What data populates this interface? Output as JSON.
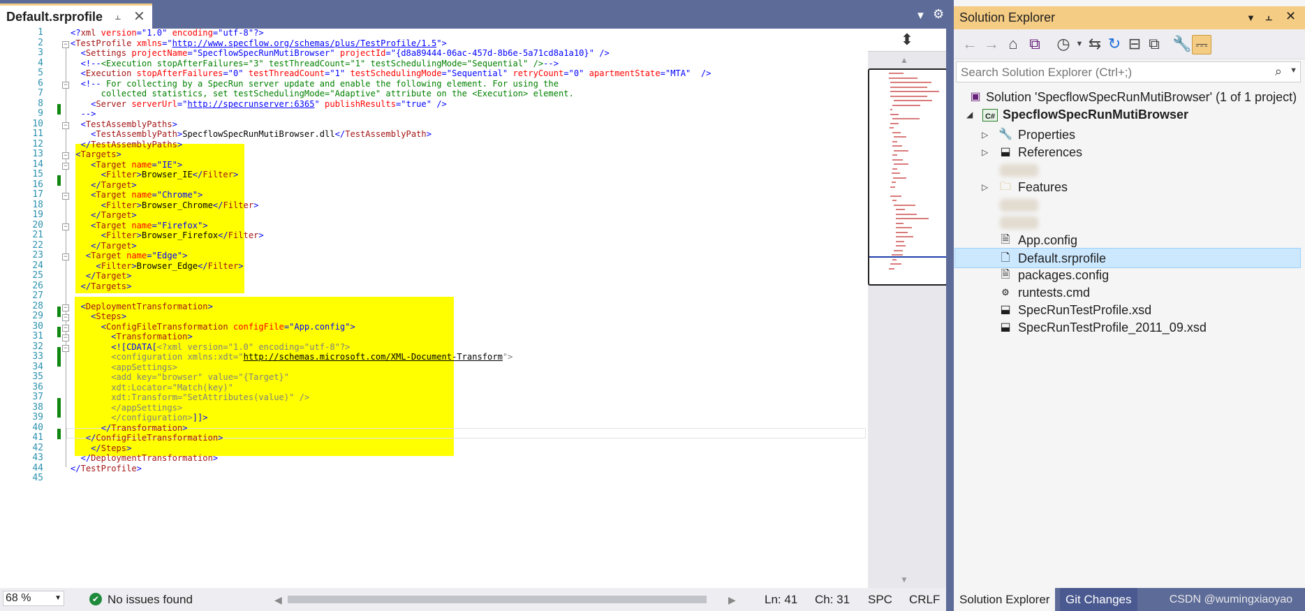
{
  "editor": {
    "tab_title": "Default.srprofile",
    "pin_icon": "pin-icon",
    "close_icon": "close-icon",
    "code_lines": [
      [
        [
          "b",
          "<?"
        ],
        [
          "e",
          "xml"
        ],
        [
          "a",
          " version"
        ],
        [
          "b",
          "=\""
        ],
        [
          "v",
          "1.0"
        ],
        [
          "b",
          "\""
        ],
        [
          "a",
          " encoding"
        ],
        [
          "b",
          "=\""
        ],
        [
          "v",
          "utf-8"
        ],
        [
          "b",
          "\"?>"
        ]
      ],
      [
        [
          "b",
          "<"
        ],
        [
          "e",
          "TestProfile"
        ],
        [
          "a",
          " xmlns"
        ],
        [
          "b",
          "=\""
        ],
        [
          "u",
          "http://www.specflow.org/schemas/plus/TestProfile/1.5"
        ],
        [
          "b",
          "\">"
        ]
      ],
      [
        [
          "k",
          "  "
        ],
        [
          "b",
          "<"
        ],
        [
          "e",
          "Settings"
        ],
        [
          "a",
          " projectName"
        ],
        [
          "b",
          "=\""
        ],
        [
          "v",
          "SpecflowSpecRunMutiBrowser"
        ],
        [
          "b",
          "\""
        ],
        [
          "a",
          " projectId"
        ],
        [
          "b",
          "=\""
        ],
        [
          "v",
          "{d8a89444-06ac-457d-8b6e-5a71cd8a1a10}"
        ],
        [
          "b",
          "\""
        ],
        [
          "b",
          " />"
        ]
      ],
      [
        [
          "k",
          "  "
        ],
        [
          "b",
          "<!--"
        ],
        [
          "c",
          "<Execution stopAfterFailures=\"3\" testThreadCount=\"1\" testSchedulingMode=\"Sequential\" />"
        ],
        [
          "b",
          "-->"
        ]
      ],
      [
        [
          "k",
          "  "
        ],
        [
          "b",
          "<"
        ],
        [
          "e",
          "Execution"
        ],
        [
          "a",
          " stopAfterFailures"
        ],
        [
          "b",
          "=\""
        ],
        [
          "v",
          "0"
        ],
        [
          "b",
          "\""
        ],
        [
          "a",
          " testThreadCount"
        ],
        [
          "b",
          "=\""
        ],
        [
          "v",
          "1"
        ],
        [
          "b",
          "\""
        ],
        [
          "a",
          " testSchedulingMode"
        ],
        [
          "b",
          "=\""
        ],
        [
          "v",
          "Sequential"
        ],
        [
          "b",
          "\""
        ],
        [
          "a",
          " retryCount"
        ],
        [
          "b",
          "=\""
        ],
        [
          "v",
          "0"
        ],
        [
          "b",
          "\""
        ],
        [
          "a",
          " apartmentState"
        ],
        [
          "b",
          "=\""
        ],
        [
          "v",
          "MTA"
        ],
        [
          "b",
          "\""
        ],
        [
          "b",
          "  />"
        ]
      ],
      [
        [
          "k",
          "  "
        ],
        [
          "b",
          "<!--"
        ],
        [
          "c",
          " For collecting by a SpecRun server update and enable the following element. For using the"
        ]
      ],
      [
        [
          "c",
          "      collected statistics, set testSchedulingMode=\"Adaptive\" attribute on the <Execution> element."
        ]
      ],
      [
        [
          "k",
          "    "
        ],
        [
          "b",
          "<"
        ],
        [
          "e",
          "Server"
        ],
        [
          "a",
          " serverUrl"
        ],
        [
          "b",
          "=\""
        ],
        [
          "u",
          "http://specrunserver:6365"
        ],
        [
          "b",
          "\""
        ],
        [
          "a",
          " publishResults"
        ],
        [
          "b",
          "=\""
        ],
        [
          "v",
          "true"
        ],
        [
          "b",
          "\""
        ],
        [
          "b",
          " />"
        ]
      ],
      [
        [
          "k",
          "  "
        ],
        [
          "b",
          "-->"
        ]
      ],
      [
        [
          "k",
          "  "
        ],
        [
          "b",
          "<"
        ],
        [
          "e",
          "TestAssemblyPaths"
        ],
        [
          "b",
          ">"
        ]
      ],
      [
        [
          "k",
          "    "
        ],
        [
          "b",
          "<"
        ],
        [
          "e",
          "TestAssemblyPath"
        ],
        [
          "b",
          ">"
        ],
        [
          "k",
          "SpecflowSpecRunMutiBrowser.dll"
        ],
        [
          "b",
          "</"
        ],
        [
          "e",
          "TestAssemblyPath"
        ],
        [
          "b",
          ">"
        ]
      ],
      [
        [
          "k",
          "  "
        ],
        [
          "b",
          "</"
        ],
        [
          "e",
          "TestAssemblyPaths"
        ],
        [
          "b",
          ">"
        ]
      ],
      [
        [
          "k",
          " "
        ],
        [
          "b",
          "<"
        ],
        [
          "e",
          "Targets"
        ],
        [
          "b",
          ">"
        ]
      ],
      [
        [
          "k",
          "    "
        ],
        [
          "b",
          "<"
        ],
        [
          "e",
          "Target"
        ],
        [
          "a",
          " name"
        ],
        [
          "b",
          "=\""
        ],
        [
          "v",
          "IE"
        ],
        [
          "b",
          "\">"
        ]
      ],
      [
        [
          "k",
          "      "
        ],
        [
          "b",
          "<"
        ],
        [
          "e",
          "Filter"
        ],
        [
          "b",
          ">"
        ],
        [
          "k",
          "Browser_IE"
        ],
        [
          "b",
          "</"
        ],
        [
          "e",
          "Filter"
        ],
        [
          "b",
          ">"
        ]
      ],
      [
        [
          "k",
          "    "
        ],
        [
          "b",
          "</"
        ],
        [
          "e",
          "Target"
        ],
        [
          "b",
          ">"
        ]
      ],
      [
        [
          "k",
          "    "
        ],
        [
          "b",
          "<"
        ],
        [
          "e",
          "Target"
        ],
        [
          "a",
          " name"
        ],
        [
          "b",
          "=\""
        ],
        [
          "v",
          "Chrome"
        ],
        [
          "b",
          "\">"
        ]
      ],
      [
        [
          "k",
          "      "
        ],
        [
          "b",
          "<"
        ],
        [
          "e",
          "Filter"
        ],
        [
          "b",
          ">"
        ],
        [
          "k",
          "Browser_Chrome"
        ],
        [
          "b",
          "</"
        ],
        [
          "e",
          "Filter"
        ],
        [
          "b",
          ">"
        ]
      ],
      [
        [
          "k",
          "    "
        ],
        [
          "b",
          "</"
        ],
        [
          "e",
          "Target"
        ],
        [
          "b",
          ">"
        ]
      ],
      [
        [
          "k",
          "    "
        ],
        [
          "b",
          "<"
        ],
        [
          "e",
          "Target"
        ],
        [
          "a",
          " name"
        ],
        [
          "b",
          "=\""
        ],
        [
          "v",
          "Firefox"
        ],
        [
          "b",
          "\">"
        ]
      ],
      [
        [
          "k",
          "      "
        ],
        [
          "b",
          "<"
        ],
        [
          "e",
          "Filter"
        ],
        [
          "b",
          ">"
        ],
        [
          "k",
          "Browser_Firefox"
        ],
        [
          "b",
          "</"
        ],
        [
          "e",
          "Filter"
        ],
        [
          "b",
          ">"
        ]
      ],
      [
        [
          "k",
          "    "
        ],
        [
          "b",
          "</"
        ],
        [
          "e",
          "Target"
        ],
        [
          "b",
          ">"
        ]
      ],
      [
        [
          "k",
          "   "
        ],
        [
          "b",
          "<"
        ],
        [
          "e",
          "Target"
        ],
        [
          "a",
          " name"
        ],
        [
          "b",
          "=\""
        ],
        [
          "v",
          "Edge"
        ],
        [
          "b",
          "\">"
        ]
      ],
      [
        [
          "k",
          "     "
        ],
        [
          "b",
          "<"
        ],
        [
          "e",
          "Filter"
        ],
        [
          "b",
          ">"
        ],
        [
          "k",
          "Browser_Edge"
        ],
        [
          "b",
          "</"
        ],
        [
          "e",
          "Filter"
        ],
        [
          "b",
          ">"
        ]
      ],
      [
        [
          "k",
          "   "
        ],
        [
          "b",
          "</"
        ],
        [
          "e",
          "Target"
        ],
        [
          "b",
          ">"
        ]
      ],
      [
        [
          "k",
          "  "
        ],
        [
          "b",
          "</"
        ],
        [
          "e",
          "Targets"
        ],
        [
          "b",
          ">"
        ]
      ],
      [],
      [
        [
          "k",
          "  "
        ],
        [
          "b",
          "<"
        ],
        [
          "e",
          "DeploymentTransformation"
        ],
        [
          "b",
          ">"
        ]
      ],
      [
        [
          "k",
          "    "
        ],
        [
          "b",
          "<"
        ],
        [
          "e",
          "Steps"
        ],
        [
          "b",
          ">"
        ]
      ],
      [
        [
          "k",
          "      "
        ],
        [
          "b",
          "<"
        ],
        [
          "e",
          "ConfigFileTransformation"
        ],
        [
          "a",
          " configFile"
        ],
        [
          "b",
          "=\""
        ],
        [
          "v",
          "App.config"
        ],
        [
          "b",
          "\">"
        ]
      ],
      [
        [
          "k",
          "        "
        ],
        [
          "b",
          "<"
        ],
        [
          "e",
          "Transformation"
        ],
        [
          "b",
          ">"
        ]
      ],
      [
        [
          "k",
          "        "
        ],
        [
          "b",
          "<![CDATA["
        ],
        [
          "g",
          "<?xml version=\"1.0\" encoding=\"utf-8\"?>"
        ]
      ],
      [
        [
          "g",
          "        <configuration xmlns:xdt=\""
        ],
        [
          "ut",
          "http://schemas.microsoft.com/XML-Document-Transform"
        ],
        [
          "g",
          "\">"
        ]
      ],
      [
        [
          "g",
          "        <appSettings>"
        ]
      ],
      [
        [
          "g",
          "        <add key=\"browser\" value=\"{Target}\""
        ]
      ],
      [
        [
          "g",
          "        xdt:Locator=\"Match(key)\""
        ]
      ],
      [
        [
          "g",
          "        xdt:Transform=\"SetAttributes(value)\" />"
        ]
      ],
      [
        [
          "g",
          "        </appSettings>"
        ]
      ],
      [
        [
          "g",
          "        </configuration>"
        ],
        [
          "b",
          "]]>"
        ]
      ],
      [
        [
          "k",
          "      "
        ],
        [
          "b",
          "</"
        ],
        [
          "e",
          "Transformation"
        ],
        [
          "b",
          ">"
        ]
      ],
      [
        [
          "k",
          "   "
        ],
        [
          "b",
          "</"
        ],
        [
          "e",
          "ConfigFileTransformation"
        ],
        [
          "b",
          ">"
        ]
      ],
      [
        [
          "k",
          "    "
        ],
        [
          "b",
          "</"
        ],
        [
          "e",
          "Steps"
        ],
        [
          "b",
          ">"
        ]
      ],
      [
        [
          "k",
          "  "
        ],
        [
          "b",
          "</"
        ],
        [
          "e",
          "DeploymentTransformation"
        ],
        [
          "b",
          ">"
        ]
      ],
      [
        [
          "b",
          "</"
        ],
        [
          "e",
          "TestProfile"
        ],
        [
          "b",
          ">"
        ]
      ],
      []
    ]
  },
  "status": {
    "zoom": "68 %",
    "issues": "No issues found",
    "line": "Ln: 41",
    "col": "Ch: 31",
    "spc": "SPC",
    "eol": "CRLF"
  },
  "solution_explorer": {
    "title": "Solution Explorer",
    "search_placeholder": "Search Solution Explorer (Ctrl+;)",
    "solution_label": "Solution 'SpecflowSpecRunMutiBrowser' (1 of 1 project)",
    "project_label": "SpecflowSpecRunMutiBrowser",
    "items": {
      "properties": "Properties",
      "references": "References",
      "features": "Features",
      "app_config": "App.config",
      "default_profile": "Default.srprofile",
      "packages_config": "packages.config",
      "runtests": "runtests.cmd",
      "xsd1": "SpecRunTestProfile.xsd",
      "xsd2": "SpecRunTestProfile_2011_09.xsd"
    },
    "bottom_tabs": [
      "Solution Explorer",
      "Git Changes"
    ],
    "watermark": "CSDN @wumingxiaoyao"
  },
  "colors": {
    "chrome": "#5d6b99",
    "active_tab_accent": "#f5cc84",
    "highlight": "#ffff00",
    "change_mark": "#108710",
    "selection": "#cce8ff"
  }
}
